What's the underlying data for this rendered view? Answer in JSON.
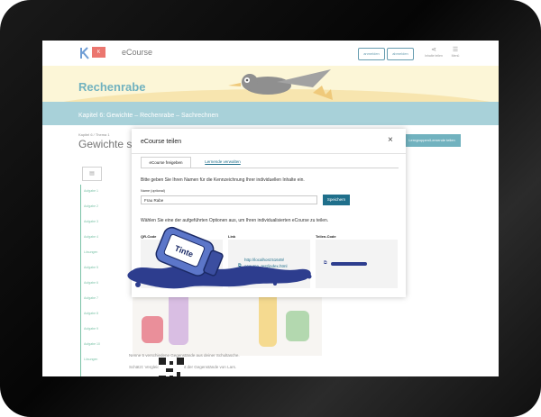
{
  "app": {
    "title": "eCourse",
    "header_buttons": [
      "anmelden",
      "abmelden"
    ],
    "share_label": "Inhalte teilen",
    "menu_label": "Menü"
  },
  "banner": {
    "title": "Rechenrabe",
    "breadcrumb": "Kapitel 6: Gewichte – Rechenrabe – Sachrechnen"
  },
  "page": {
    "small_crumb": "Kapitel 6 / Thema 1",
    "title": "Gewichte sc",
    "action_button": "Lerngruppen/Lernende teilen",
    "side_items": [
      "Aufgabe 1",
      "Aufgabe 2",
      "Aufgabe 3",
      "Aufgabe 4",
      "Lösungen",
      "Aufgabe 5",
      "Aufgabe 6",
      "Aufgabe 7",
      "Aufgabe 8",
      "Aufgabe 9",
      "Aufgabe 10",
      "Lösungen"
    ],
    "text_lines": [
      "Nenne 5 verschiedene Gegenstände aus deiner Schultasche.",
      "Schätzt: Vergleicht das Gewicht der Gegenstände von Lars."
    ]
  },
  "modal": {
    "title": "eCourse teilen",
    "close_label": "×",
    "tabs": [
      {
        "label": "eCourse freigeben",
        "active": true
      },
      {
        "label": "Lernende verwalten",
        "active": false
      }
    ],
    "intro": "Bitte geben Sie Ihren Namen für die Kennzeichnung Ihrer individuellen Inhalte ein.",
    "name_label": "Name (optional)",
    "name_value": "Frau Rabe",
    "save_label": "Speichern",
    "options_text": "Wählen Sie eine der aufgeführten Optionen aus, um Ihren individualisierten eCourse zu teilen.",
    "columns": [
      {
        "heading": "QR-Code"
      },
      {
        "heading": "Link",
        "link_line1": "http://localhost:51649/",
        "link_line2": "ecourse_test/index.html"
      },
      {
        "heading": "Teilen-Code"
      }
    ]
  },
  "illustration": {
    "ink_bottle_label": "Tinte",
    "ink_color": "#2d3d8e"
  },
  "colors": {
    "accent": "#1f6f8b",
    "banner_teal": "#7fbcc7",
    "green": "#3aa57c",
    "logo_red": "#e2352b"
  }
}
